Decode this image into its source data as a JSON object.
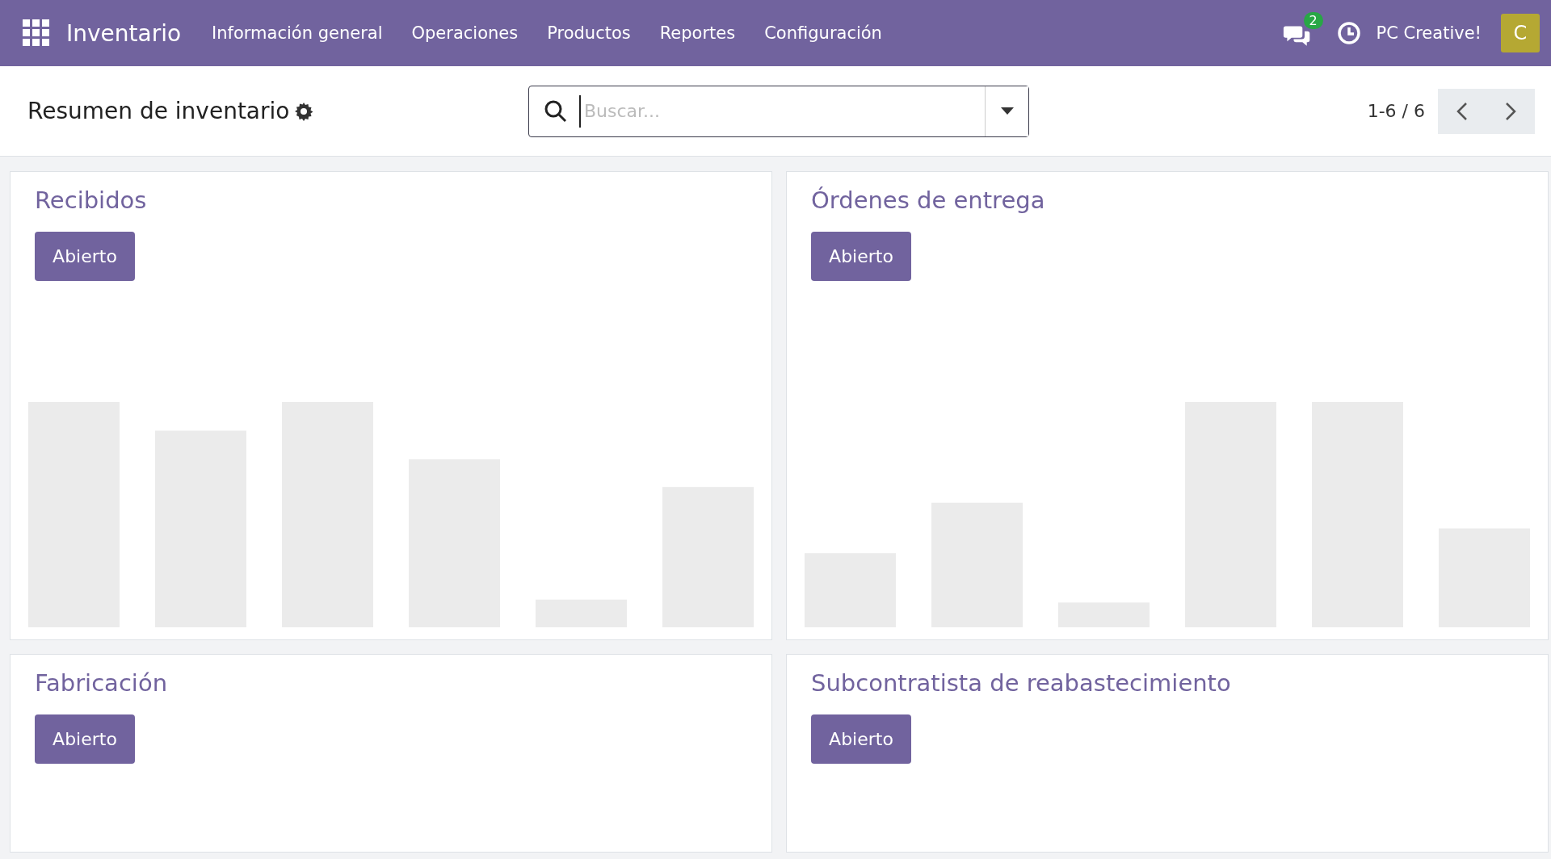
{
  "navbar": {
    "app_name": "Inventario",
    "menu": [
      "Información general",
      "Operaciones",
      "Productos",
      "Reportes",
      "Configuración"
    ],
    "messages_badge": "2",
    "company": "PC Creative!",
    "avatar_letter": "C"
  },
  "control_panel": {
    "title": "Resumen de inventario",
    "search": {
      "placeholder": "Buscar..."
    },
    "pager": "1-6 / 6"
  },
  "cards": [
    {
      "title": "Recibidos",
      "button": "Abierto",
      "kind": "chart"
    },
    {
      "title": "Órdenes de entrega",
      "button": "Abierto",
      "kind": "chart"
    },
    {
      "title": "Fabricación",
      "button": "Abierto",
      "kind": "plain"
    },
    {
      "title": "Subcontratista de reabastecimiento",
      "button": "Abierto",
      "kind": "plain"
    }
  ]
}
